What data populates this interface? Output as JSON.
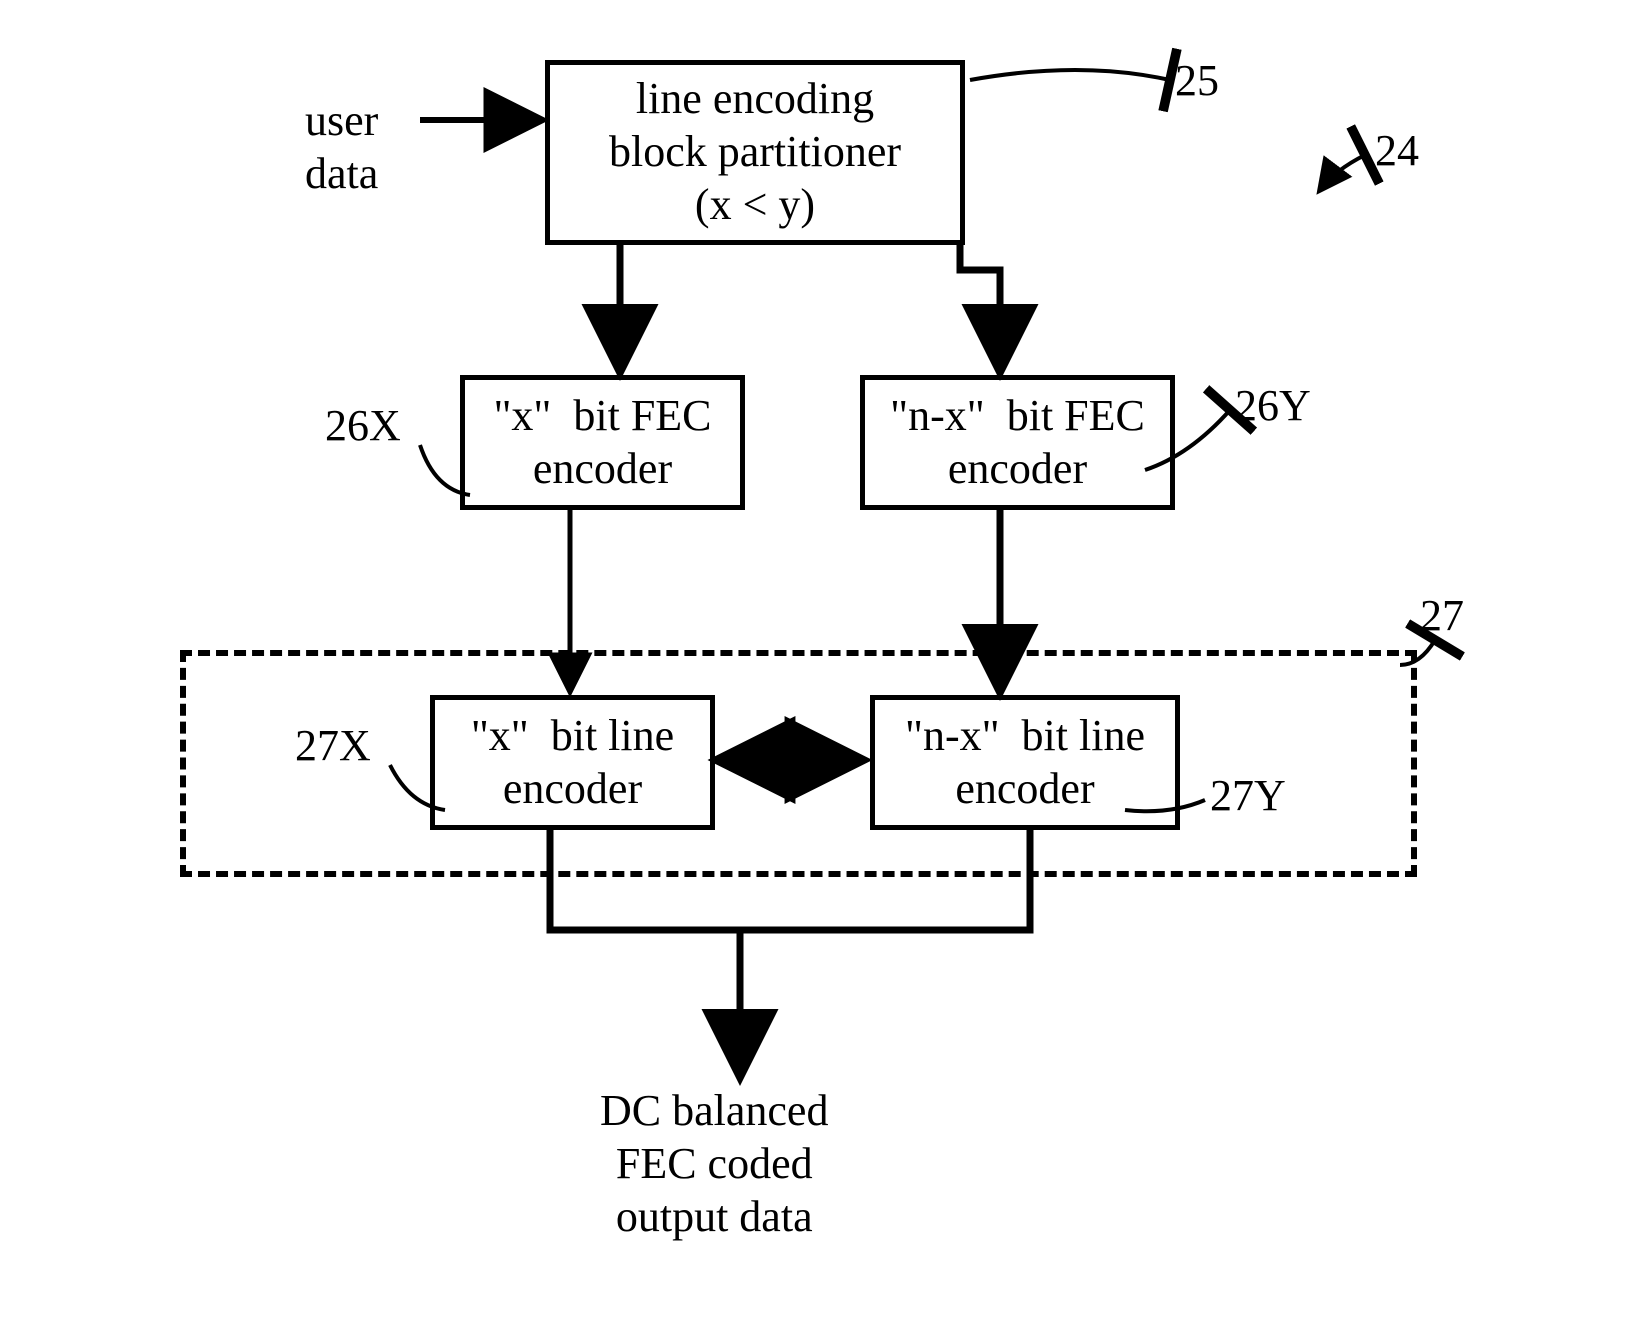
{
  "input_label": "user\ndata",
  "box25": "line encoding\nblock partitioner\n(x < y)",
  "box26X": "\"x\"  bit FEC\nencoder",
  "box26Y": "\"n-x\"  bit FEC\nencoder",
  "box27X": "\"x\"  bit line\nencoder",
  "box27Y": "\"n-x\"  bit line\nencoder",
  "output_label": "DC balanced\nFEC coded\noutput data",
  "ref25": "25",
  "ref24": "24",
  "ref26X": "26X",
  "ref26Y": "26Y",
  "ref27": "27",
  "ref27X": "27X",
  "ref27Y": "27Y"
}
